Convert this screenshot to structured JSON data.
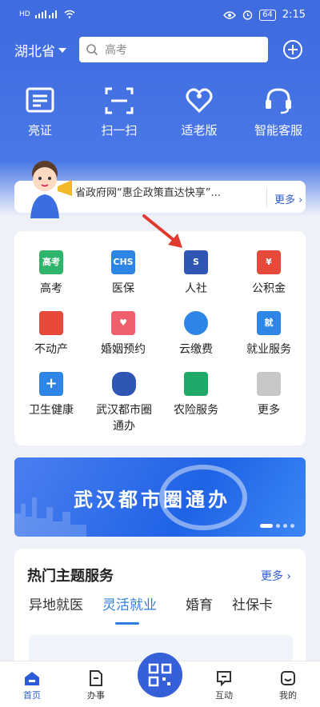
{
  "status": {
    "left": "HD",
    "battery": "64",
    "time": "2:15"
  },
  "header": {
    "province": "湖北省",
    "search_placeholder": "高考"
  },
  "quick_actions": [
    {
      "label": "亮证",
      "icon": "id-card-icon"
    },
    {
      "label": "扫一扫",
      "icon": "scan-icon"
    },
    {
      "label": "适老版",
      "icon": "elderly-heart-icon"
    },
    {
      "label": "智能客服",
      "icon": "headset-icon"
    }
  ],
  "notice": {
    "text": "省政府网“惠企政策直达快享”...",
    "more": "更多"
  },
  "services": [
    {
      "label": "高考",
      "icon_text": "高考",
      "color": "#2fb56b"
    },
    {
      "label": "医保",
      "icon_text": "CHS",
      "color": "#2d86e6"
    },
    {
      "label": "人社",
      "icon_text": "S",
      "color": "#2f55b5"
    },
    {
      "label": "公积金",
      "icon_text": "¥",
      "color": "#e8483c"
    },
    {
      "label": "不动产",
      "icon_text": "",
      "color": "#e8483c"
    },
    {
      "label": "婚姻预约",
      "icon_text": "♥",
      "color": "#f0606c"
    },
    {
      "label": "云缴费",
      "icon_text": "",
      "color": "#2d86e6"
    },
    {
      "label": "就业服务",
      "icon_text": "就",
      "color": "#2d86e6"
    },
    {
      "label": "卫生健康",
      "icon_text": "+",
      "color": "#2d86e6"
    },
    {
      "label": "武汉都市圈通办",
      "icon_text": "",
      "color": "#2f55b5"
    },
    {
      "label": "农险服务",
      "icon_text": "",
      "color": "#1faa6a"
    },
    {
      "label": "更多",
      "icon_text": "",
      "color": "#c7c7c7"
    }
  ],
  "banner": {
    "title": "武汉都市圈通办"
  },
  "hot": {
    "title": "热门主题服务",
    "more": "更多",
    "tabs": [
      "异地就医",
      "灵活就业",
      "婚育",
      "社保卡"
    ]
  },
  "nav": [
    {
      "label": "首页",
      "icon": "home-icon"
    },
    {
      "label": "办事",
      "icon": "document-icon"
    },
    {
      "label": "互动",
      "icon": "chat-icon"
    },
    {
      "label": "我的",
      "icon": "user-icon"
    }
  ]
}
